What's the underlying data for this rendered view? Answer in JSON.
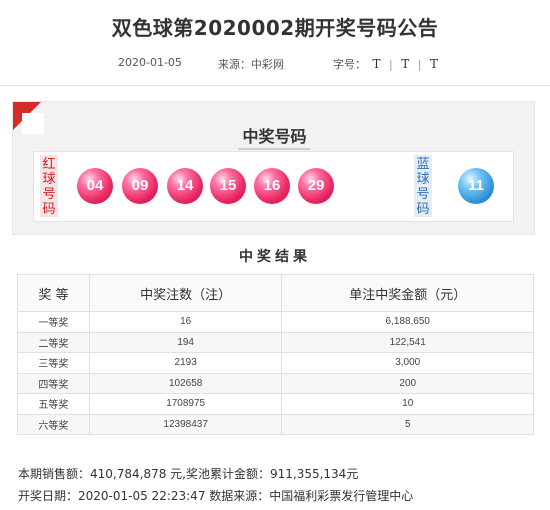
{
  "header": {
    "title": "双色球第2020002期开奖号码公告",
    "date": "2020-01-05",
    "source": "来源：中彩网",
    "font_size_label": "字号：",
    "font_size_options": [
      "T",
      "T",
      "T"
    ],
    "font_size_separator": "|"
  },
  "draw": {
    "panel_title": "中奖号码",
    "red_label": "红球号码",
    "blue_label": "蓝球号码",
    "red_balls": [
      "04",
      "09",
      "14",
      "15",
      "16",
      "29"
    ],
    "blue_ball": "11",
    "colors": {
      "red_ball": "#e8245e",
      "blue_ball": "#2c8fd8",
      "corner": "#d42b2b"
    }
  },
  "results": {
    "title": "中奖结果",
    "columns": [
      "奖 等",
      "中奖注数（注）",
      "单注中奖金额（元）"
    ],
    "rows": [
      [
        "一等奖",
        "16",
        "6,188,650"
      ],
      [
        "二等奖",
        "194",
        "122,541"
      ],
      [
        "三等奖",
        "2193",
        "3,000"
      ],
      [
        "四等奖",
        "102658",
        "200"
      ],
      [
        "五等奖",
        "1708975",
        "10"
      ],
      [
        "六等奖",
        "12398437",
        "5"
      ]
    ]
  },
  "footer": {
    "sales": "本期销售额：410,784,878 元,奖池累计金额：911,355,134元",
    "draw_time": "开奖日期：2020-01-05  22:23:47 数据来源：中国福利彩票发行管理中心"
  }
}
